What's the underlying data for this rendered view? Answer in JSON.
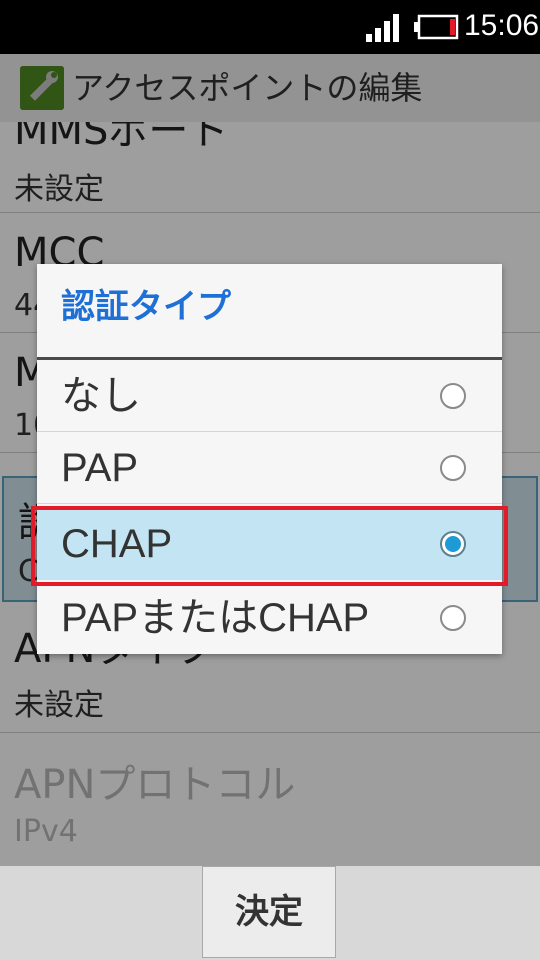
{
  "status_bar": {
    "time": "15:06",
    "signal_icon": "signal-icon",
    "battery_icon": "battery-low-icon",
    "battery_color": "#e11b2a"
  },
  "header": {
    "title": "アクセスポイントの編集",
    "icon": "wrench-icon"
  },
  "settings": [
    {
      "title": "MMSポート",
      "value": "未設定"
    },
    {
      "title": "MCC",
      "value": "44"
    },
    {
      "title": "M",
      "value": "10"
    },
    {
      "title": "認",
      "value": "C"
    },
    {
      "title": "APNタイプ",
      "value": "未設定"
    },
    {
      "title": "APNプロトコル",
      "value": "IPv4"
    }
  ],
  "dialog": {
    "title": "認証タイプ",
    "options": [
      {
        "label": "なし",
        "selected": false
      },
      {
        "label": "PAP",
        "selected": false
      },
      {
        "label": "CHAP",
        "selected": true
      },
      {
        "label": "PAPまたはCHAP",
        "selected": false
      }
    ]
  },
  "footer": {
    "ok_label": "決定"
  },
  "colors": {
    "accent": "#1e6fd6",
    "selection": "#c3e5f3",
    "radio_fill": "#1e9ad6",
    "highlight": "#e11b2a"
  }
}
